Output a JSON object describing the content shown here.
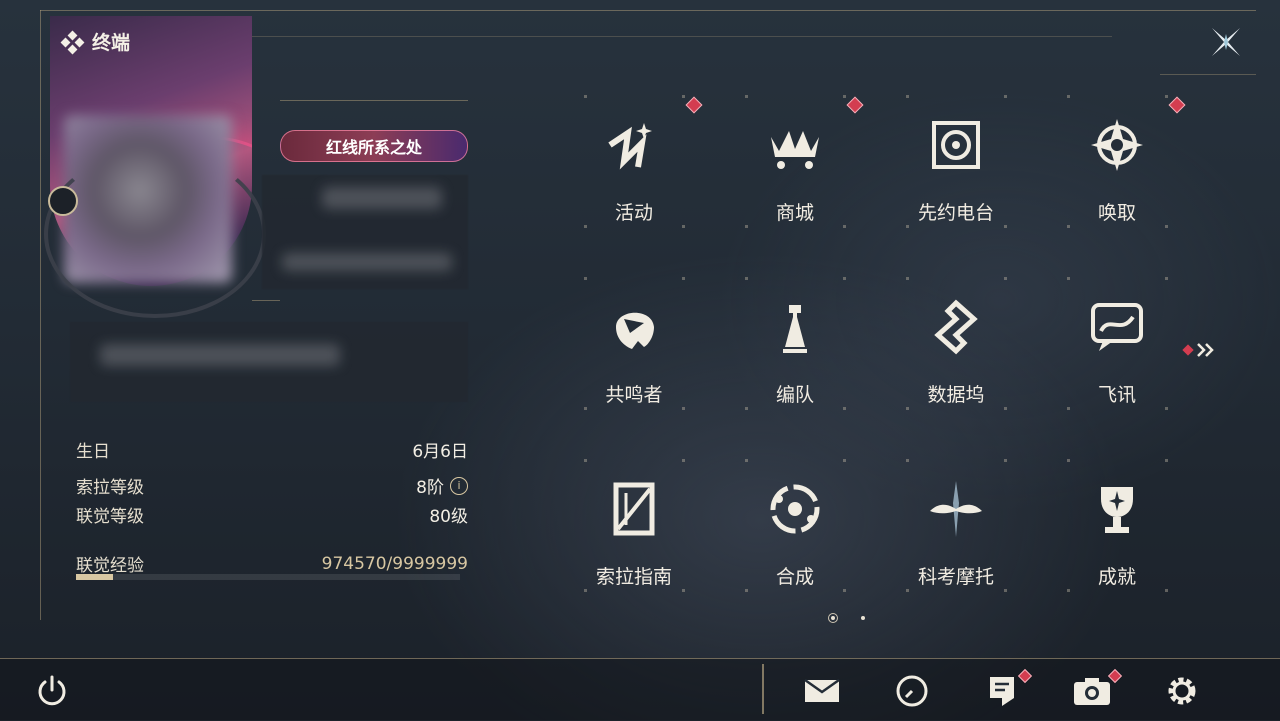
{
  "header": {
    "title": "终端"
  },
  "profile": {
    "title_badge": "红线所系之处",
    "birthday_label": "生日",
    "birthday_value": "6月6日",
    "sola_level_label": "索拉等级",
    "sola_level_value": "8阶",
    "union_level_label": "联觉等级",
    "union_level_value": "80级",
    "union_exp_label": "联觉经验",
    "union_exp_value": "974570/9999999",
    "exp_fraction": 0.097
  },
  "menu": {
    "items": [
      {
        "label": "活动",
        "icon": "event-icon",
        "badge": true
      },
      {
        "label": "商城",
        "icon": "shop-crown-icon",
        "badge": true
      },
      {
        "label": "先约电台",
        "icon": "radio-icon",
        "badge": false
      },
      {
        "label": "唤取",
        "icon": "convene-compass-icon",
        "badge": true
      },
      {
        "label": "共鸣者",
        "icon": "resonator-icon",
        "badge": false
      },
      {
        "label": "编队",
        "icon": "team-chess-icon",
        "badge": false
      },
      {
        "label": "数据坞",
        "icon": "data-bank-icon",
        "badge": false
      },
      {
        "label": "飞讯",
        "icon": "chat-icon",
        "badge": false
      },
      {
        "label": "索拉指南",
        "icon": "guide-book-icon",
        "badge": false
      },
      {
        "label": "合成",
        "icon": "synthesis-icon",
        "badge": false
      },
      {
        "label": "科考摩托",
        "icon": "motorcycle-icon",
        "badge": false
      },
      {
        "label": "成就",
        "icon": "trophy-icon",
        "badge": false
      }
    ],
    "page_count": 2,
    "current_page": 1
  },
  "bottom": {
    "icons": [
      "mail-icon",
      "clock-icon",
      "notice-icon",
      "camera-icon",
      "settings-gear-icon"
    ]
  },
  "colors": {
    "accent": "#d8c7a2",
    "badge": "#d33d50",
    "bg": "#242d37"
  }
}
